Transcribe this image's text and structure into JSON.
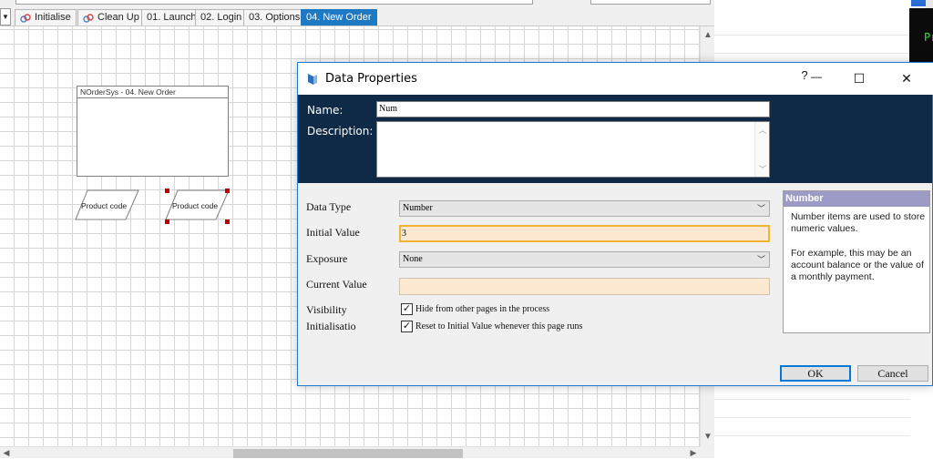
{
  "tabs": [
    {
      "label": "Initialise",
      "icon": "stage-link-icon"
    },
    {
      "label": "Clean Up",
      "icon": "stage-link-icon"
    },
    {
      "label": "01. Launch"
    },
    {
      "label": "02. Login"
    },
    {
      "label": "03. Options"
    },
    {
      "label": "04. New Order",
      "active": true
    }
  ],
  "canvas": {
    "page_box_title": "NOrderSys - 04. New Order",
    "data_item_1": "Product code",
    "data_item_2": "Product code"
  },
  "background_window": {
    "terminal_text": "Pr"
  },
  "dialog": {
    "title": "Data Properties",
    "controls": {
      "help": "?",
      "minimize": "—",
      "maximize": "☐",
      "close": "✕"
    },
    "name_label": "Name:",
    "name_value": "Num",
    "description_label": "Description:",
    "description_value": "",
    "fields": {
      "data_type_label": "Data Type",
      "data_type_value": "Number",
      "initial_value_label": "Initial Value",
      "initial_value": "3",
      "exposure_label": "Exposure",
      "exposure_value": "None",
      "current_value_label": "Current Value",
      "current_value": "",
      "visibility_label": "Visibility",
      "visibility_checkbox_label": "Hide from other pages in the process",
      "visibility_checked": true,
      "initialisation_label": "Initialisatio",
      "initialisation_checkbox_label": "Reset to Initial Value whenever this page runs",
      "initialisation_checked": true
    },
    "help": {
      "heading": "Number",
      "para1": "Number items are used to store numeric values.",
      "para2": "For example, this may be an account balance or the value of a monthly payment."
    },
    "buttons": {
      "ok": "OK",
      "cancel": "Cancel"
    }
  },
  "colors": {
    "tab_active": "#1e78c2",
    "header_band": "#0e2a47",
    "help_heading": "#9b9bc6",
    "field_bg": "#fde9d2",
    "focus_border": "#f2b233",
    "terminal_text": "#2ee62e"
  }
}
